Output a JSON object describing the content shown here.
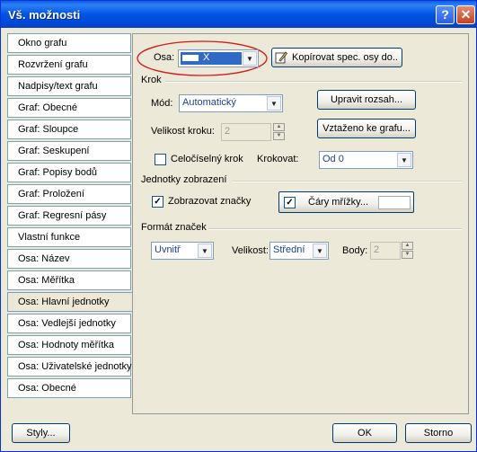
{
  "window": {
    "title": "Vš. možnosti"
  },
  "sidebar": {
    "items": [
      {
        "label": "Okno grafu"
      },
      {
        "label": "Rozvržení grafu"
      },
      {
        "label": "Nadpisy/text grafu"
      },
      {
        "label": "Graf: Obecné"
      },
      {
        "label": "Graf: Sloupce"
      },
      {
        "label": "Graf: Seskupení"
      },
      {
        "label": "Graf: Popisy bodů"
      },
      {
        "label": "Graf: Proložení"
      },
      {
        "label": "Graf: Regresní pásy"
      },
      {
        "label": "Vlastní funkce"
      },
      {
        "label": "Osa: Název"
      },
      {
        "label": "Osa: Měřítka"
      },
      {
        "label": "Osa: Hlavní jednotky",
        "selected": true
      },
      {
        "label": "Osa: Vedlejší jednotky"
      },
      {
        "label": "Osa: Hodnoty měřítka"
      },
      {
        "label": "Osa: Uživatelské jednotky"
      },
      {
        "label": "Osa: Obecné"
      }
    ]
  },
  "axis": {
    "label": "Osa:",
    "value": "X",
    "copy_button": "Kopírovat spec. osy do.."
  },
  "step": {
    "group": "Krok",
    "mode_label": "Mód:",
    "mode_value": "Automatický",
    "adjust_button": "Upravit rozsah...",
    "size_label": "Velikost kroku:",
    "size_value": "2",
    "related_button": "Vztaženo ke grafu...",
    "integer_label": "Celočíselný krok",
    "integer_checked": false,
    "stepping_label": "Krokovat:",
    "stepping_value": "Od 0"
  },
  "display": {
    "group": "Jednotky zobrazení",
    "show_marks_label": "Zobrazovat značky",
    "show_marks_checked": true,
    "grid_checked": true,
    "grid_button": "Čáry mřížky..."
  },
  "marks": {
    "group": "Formát značek",
    "position_value": "Uvnitř",
    "size_label": "Velikost:",
    "size_value": "Střední",
    "points_label": "Body:",
    "points_value": "2"
  },
  "footer": {
    "styles": "Styly...",
    "ok": "OK",
    "cancel": "Storno"
  },
  "colors": {
    "titlebar": "#0054e3",
    "combo_selected": "#316ac5",
    "highlight_ellipse": "#d11a1a"
  }
}
